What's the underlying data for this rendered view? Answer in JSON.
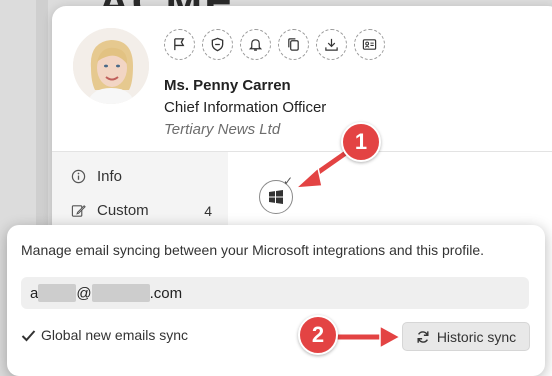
{
  "background": {
    "logo_text": "ACME"
  },
  "profile": {
    "name": "Ms. Penny Carren",
    "title": "Chief Information Officer",
    "company": "Tertiary News Ltd",
    "actions": [
      "flag-icon",
      "shield-icon",
      "bell-icon",
      "copy-icon",
      "download-icon",
      "id-card-icon"
    ]
  },
  "sidebar": {
    "items": [
      {
        "label": "Info",
        "icon": "info-icon",
        "count": ""
      },
      {
        "label": "Custom",
        "icon": "edit-icon",
        "count": "4"
      }
    ]
  },
  "integrations": {
    "windows_button_icon": "windows-icon",
    "connected_mark": "✓"
  },
  "annotations": {
    "badge_1": "1",
    "badge_2": "2",
    "color": "#e34343"
  },
  "popover": {
    "description": "Manage email syncing between your Microsoft integrations and this profile.",
    "email": {
      "prefix": "a",
      "at": "@",
      "suffix": ".com"
    },
    "global_sync_label": "Global new emails sync",
    "global_sync_checked": true,
    "historic_sync_label": "Historic sync"
  }
}
